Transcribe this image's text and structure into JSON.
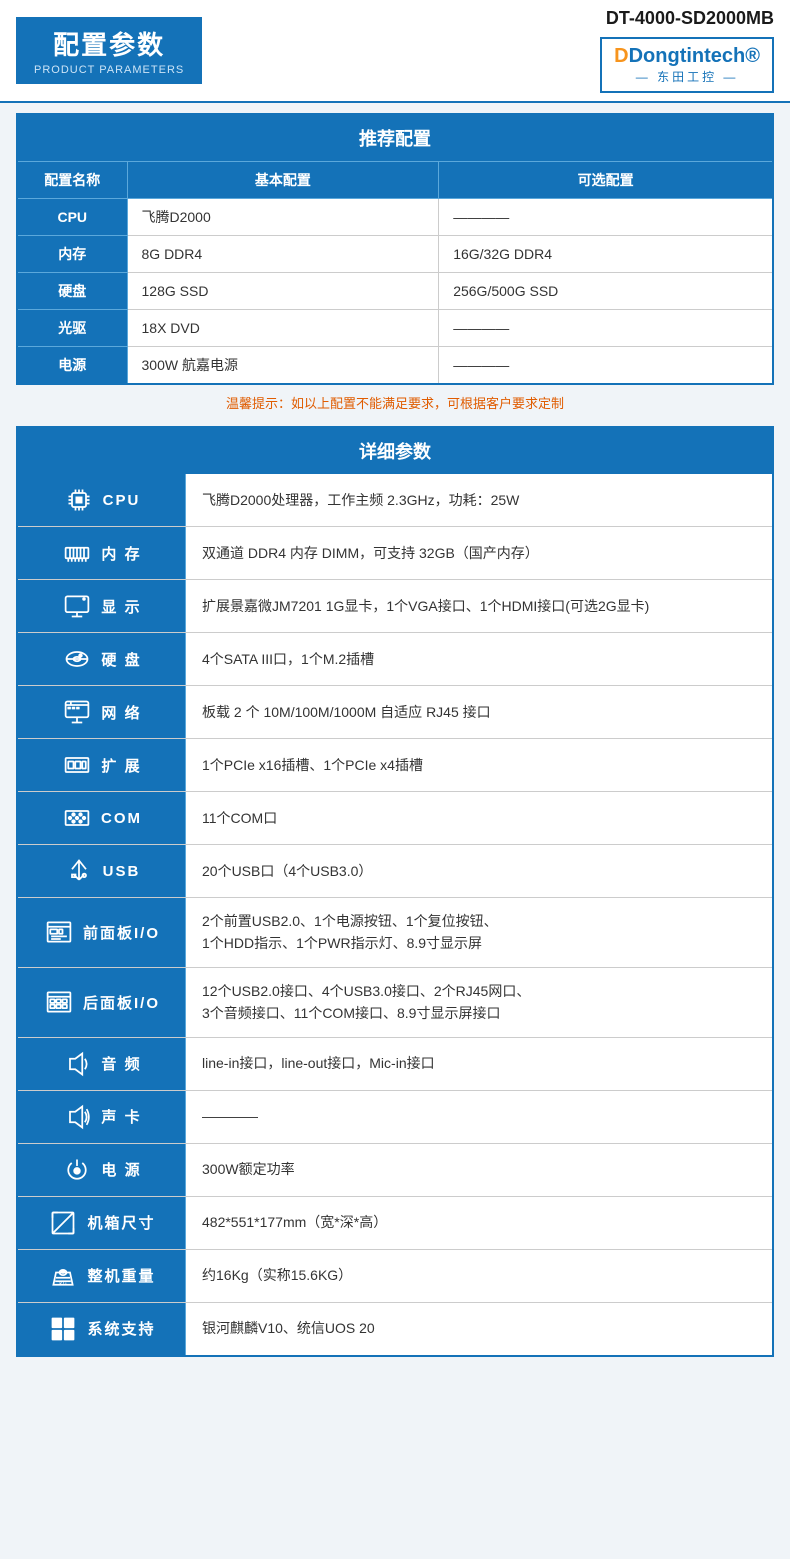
{
  "header": {
    "title_cn": "配置参数",
    "title_en": "PRODUCT PARAMETERS",
    "product_code": "DT-4000-SD2000MB",
    "brand_name": "Dongtintech",
    "brand_name_prefix": "D",
    "brand_cn": "— 东田工控 —"
  },
  "recommend": {
    "section_title": "推荐配置",
    "columns": [
      "配置名称",
      "基本配置",
      "可选配置"
    ],
    "rows": [
      {
        "label": "CPU",
        "basic": "飞腾D2000",
        "optional": "————"
      },
      {
        "label": "内存",
        "basic": "8G DDR4",
        "optional": "16G/32G DDR4"
      },
      {
        "label": "硬盘",
        "basic": "128G SSD",
        "optional": "256G/500G SSD"
      },
      {
        "label": "光驱",
        "basic": "18X DVD",
        "optional": "————"
      },
      {
        "label": "电源",
        "basic": "300W 航嘉电源",
        "optional": "————"
      }
    ],
    "warm_tip": "温馨提示：如以上配置不能满足要求，可根据客户要求定制"
  },
  "detail": {
    "section_title": "详细参数",
    "rows": [
      {
        "id": "cpu",
        "label": "CPU",
        "value": "飞腾D2000处理器，工作主频 2.3GHz，功耗：25W",
        "icon": "cpu"
      },
      {
        "id": "memory",
        "label": "内 存",
        "value": "双通道 DDR4 内存 DIMM，可支持 32GB（国产内存）",
        "icon": "memory"
      },
      {
        "id": "display",
        "label": "显 示",
        "value": "扩展景嘉微JM7201 1G显卡，1个VGA接口、1个HDMI接口(可选2G显卡)",
        "icon": "display"
      },
      {
        "id": "hdd",
        "label": "硬 盘",
        "value": "4个SATA III口，1个M.2插槽",
        "icon": "hdd"
      },
      {
        "id": "network",
        "label": "网 络",
        "value": "板载 2 个 10M/100M/1000M 自适应 RJ45 接口",
        "icon": "network"
      },
      {
        "id": "expand",
        "label": "扩 展",
        "value": "1个PCIe x16插槽、1个PCIe x4插槽",
        "icon": "expand"
      },
      {
        "id": "com",
        "label": "COM",
        "value": "11个COM口",
        "icon": "com"
      },
      {
        "id": "usb",
        "label": "USB",
        "value": "20个USB口（4个USB3.0）",
        "icon": "usb"
      },
      {
        "id": "front-io",
        "label": "前面板I/O",
        "value": "2个前置USB2.0、1个电源按钮、1个复位按钮、\n1个HDD指示、1个PWR指示灯、8.9寸显示屏",
        "icon": "front"
      },
      {
        "id": "back-io",
        "label": "后面板I/O",
        "value": "12个USB2.0接口、4个USB3.0接口、2个RJ45网口、\n3个音频接口、11个COM接口、8.9寸显示屏接口",
        "icon": "back"
      },
      {
        "id": "audio",
        "label": "音 频",
        "value": "line-in接口，line-out接口，Mic-in接口",
        "icon": "audio"
      },
      {
        "id": "soundcard",
        "label": "声 卡",
        "value": "————",
        "icon": "soundcard"
      },
      {
        "id": "power",
        "label": "电 源",
        "value": "300W额定功率",
        "icon": "power"
      },
      {
        "id": "size",
        "label": "机箱尺寸",
        "value": "482*551*177mm（宽*深*高）",
        "icon": "size"
      },
      {
        "id": "weight",
        "label": "整机重量",
        "value": "约16Kg（实称15.6KG）",
        "icon": "weight"
      },
      {
        "id": "system",
        "label": "系统支持",
        "value": "银河麒麟V10、统信UOS 20",
        "icon": "system"
      }
    ]
  },
  "icons": {
    "cpu": "🖥",
    "memory": "🔲",
    "display": "🖱",
    "hdd": "💾",
    "network": "📁",
    "expand": "🔳",
    "com": "🔌",
    "usb": "⚡",
    "front": "📋",
    "back": "📋",
    "audio": "🔊",
    "soundcard": "🔊",
    "power": "⚡",
    "size": "📐",
    "weight": "⚖",
    "system": "🪟"
  }
}
